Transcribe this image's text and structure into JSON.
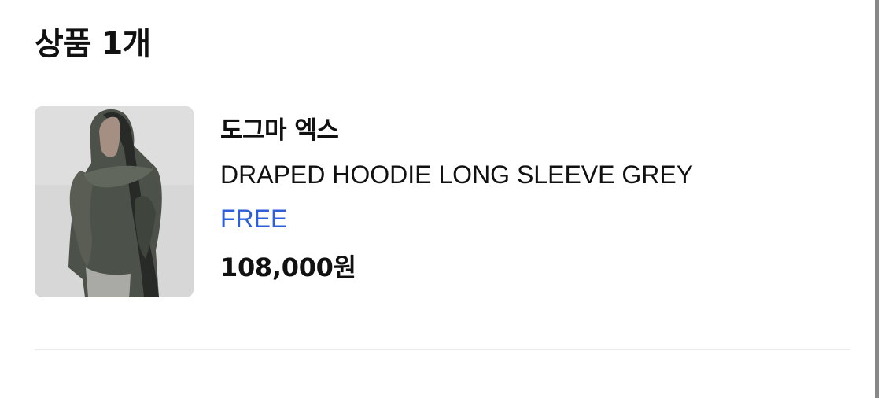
{
  "section": {
    "title": "상품 1개"
  },
  "product": {
    "image_alt": "DRAPED HOODIE LONG SLEEVE GREY",
    "brand": "도그마 엑스",
    "name": "DRAPED HOODIE LONG SLEEVE GREY",
    "option": "FREE",
    "price": "108,000원"
  },
  "colors": {
    "option_text": "#2d5fd8",
    "divider": "#e9e9e9",
    "scrollbar": "#888888"
  }
}
